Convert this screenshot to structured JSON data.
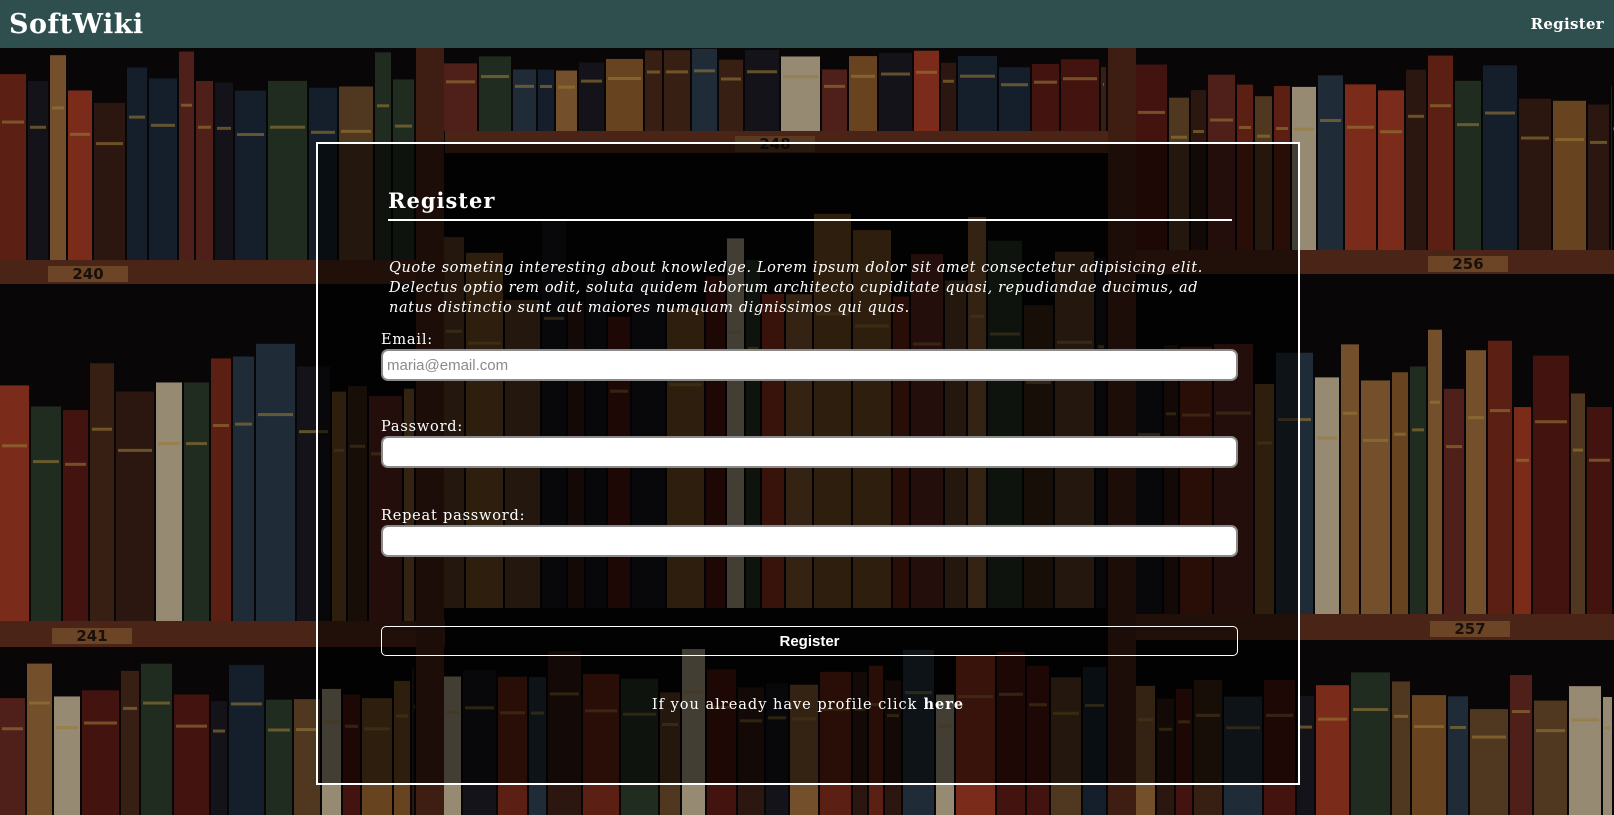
{
  "header": {
    "brand": "SoftWiki",
    "nav_register": "Register"
  },
  "shelf_labels": [
    "248",
    "240",
    "256",
    "241",
    "257"
  ],
  "form": {
    "title": "Register",
    "quote": "Quote someting interesting about knowledge. Lorem ipsum dolor sit amet consectetur adipisicing elit. Delectus optio rem odit, soluta quidem laborum architecto cupiditate quasi, repudiandae ducimus, ad natus distinctio sunt aut maiores numquam dignissimos qui quas.",
    "email_label": "Email:",
    "email_placeholder": "maria@email.com",
    "email_value": "",
    "password_label": "Password:",
    "password_value": "",
    "repeat_label": "Repeat password:",
    "repeat_value": "",
    "submit_label": "Register",
    "login_prompt": "If you already have profile click",
    "login_link": "here"
  },
  "colors": {
    "header_bg": "#2f4f4f",
    "panel_border": "#ffffff",
    "text": "#ffffff"
  }
}
